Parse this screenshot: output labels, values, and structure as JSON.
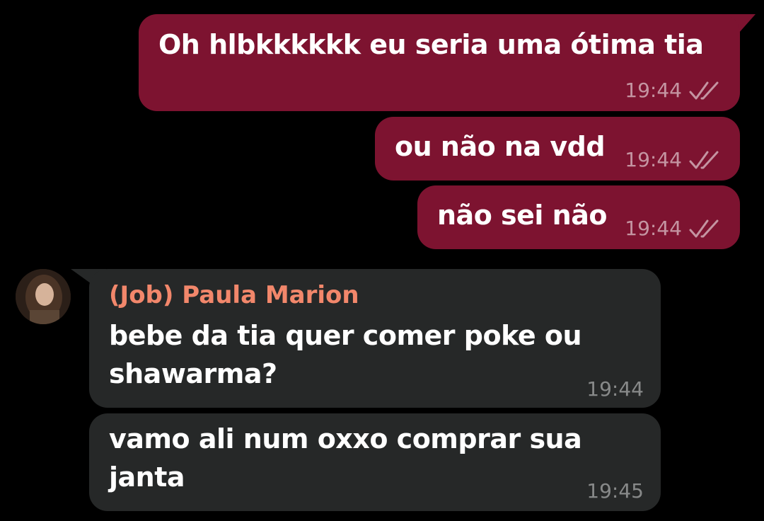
{
  "colors": {
    "background": "#000000",
    "outgoing_bubble": "#7d1330",
    "incoming_bubble": "#262828",
    "sender_name": "#f2876b"
  },
  "icons": {
    "read_receipt": "double-check-icon",
    "avatar": "contact-avatar"
  },
  "messages": [
    {
      "direction": "outgoing",
      "text": "Oh hlbkkkkkk eu seria uma ótima tia",
      "time": "19:44",
      "status": "read"
    },
    {
      "direction": "outgoing",
      "text": "ou não na vdd",
      "time": "19:44",
      "status": "read"
    },
    {
      "direction": "outgoing",
      "text": "não sei não",
      "time": "19:44",
      "status": "read"
    },
    {
      "direction": "incoming",
      "sender": "(Job) Paula Marion",
      "text_lines": [
        "bebe da tia quer comer poke ou",
        "shawarma?"
      ],
      "time": "19:44"
    },
    {
      "direction": "incoming",
      "text_lines": [
        "vamo ali num oxxo comprar sua",
        "janta"
      ],
      "time": "19:45"
    }
  ]
}
